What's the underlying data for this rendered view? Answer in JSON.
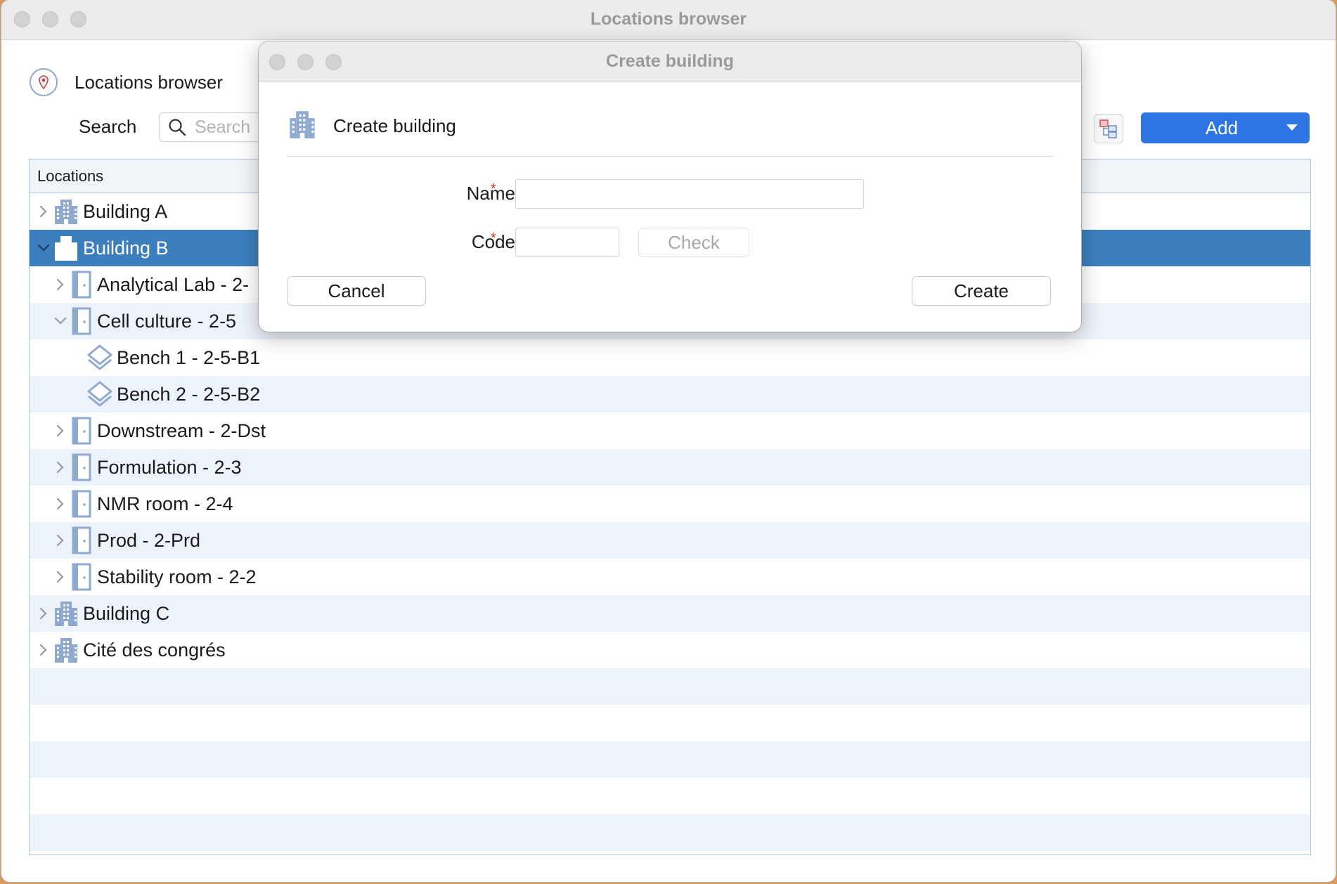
{
  "window": {
    "title": "Locations browser"
  },
  "header": {
    "title": "Locations browser",
    "icon": "location-pin-icon"
  },
  "toolbar": {
    "search_label": "Search",
    "search_placeholder": "Search",
    "add_label": "Add"
  },
  "tree": {
    "column_header": "Locations",
    "rows": [
      {
        "label": "Building A",
        "type": "building",
        "level": 0,
        "expanded": false
      },
      {
        "label": "Building B",
        "type": "building",
        "level": 0,
        "expanded": true,
        "selected": true
      },
      {
        "label": "Analytical Lab - 2-",
        "type": "room",
        "level": 1,
        "expanded": false
      },
      {
        "label": "Cell culture - 2-5",
        "type": "room",
        "level": 1,
        "expanded": true
      },
      {
        "label": "Bench 1 - 2-5-B1",
        "type": "bench",
        "level": 2
      },
      {
        "label": "Bench 2 - 2-5-B2",
        "type": "bench",
        "level": 2
      },
      {
        "label": "Downstream - 2-Dst",
        "type": "room",
        "level": 1,
        "expanded": false
      },
      {
        "label": "Formulation - 2-3",
        "type": "room",
        "level": 1,
        "expanded": false
      },
      {
        "label": "NMR room - 2-4",
        "type": "room",
        "level": 1,
        "expanded": false
      },
      {
        "label": "Prod - 2-Prd",
        "type": "room",
        "level": 1,
        "expanded": false
      },
      {
        "label": "Stability room - 2-2",
        "type": "room",
        "level": 1,
        "expanded": false
      },
      {
        "label": "Building C",
        "type": "building",
        "level": 0,
        "expanded": false
      },
      {
        "label": "Cité des congrés",
        "type": "building",
        "level": 0,
        "expanded": false
      }
    ]
  },
  "dialog": {
    "window_title": "Create building",
    "heading": "Create building",
    "name_label": "Name",
    "code_label": "Code",
    "required_marker": "*",
    "name_value": "",
    "code_value": "",
    "check_label": "Check",
    "cancel_label": "Cancel",
    "create_label": "Create"
  },
  "colors": {
    "accent": "#2f74e3",
    "selection": "#3d7fbd",
    "icon": "#8fa9cf",
    "required": "#d0342c"
  }
}
